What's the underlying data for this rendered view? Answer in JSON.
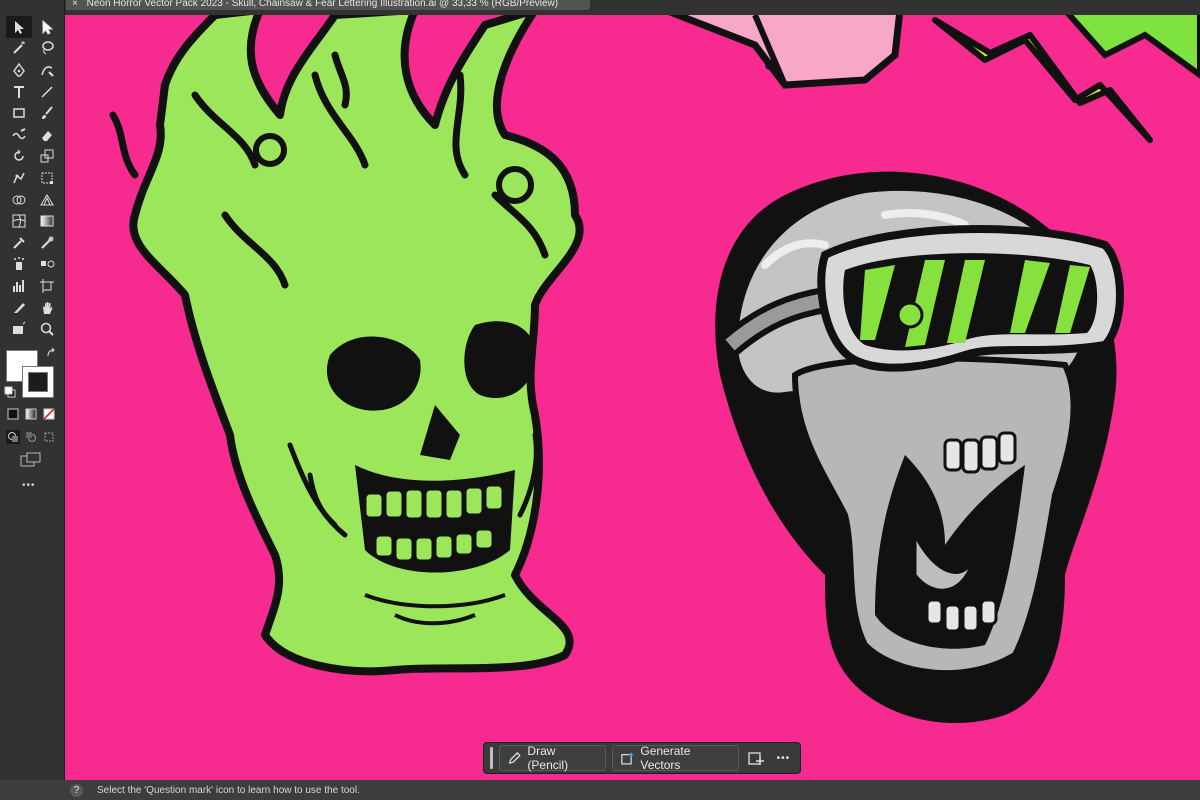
{
  "document_tab": {
    "close_glyph": "×",
    "title": "Neon Horror Vector Pack 2023 - Skull, Chainsaw & Fear Lettering Illustration.ai @ 33,33 % (RGB/Preview)"
  },
  "toolbar": {
    "tools": [
      {
        "name": "selection-tool-icon",
        "selected": true
      },
      {
        "name": "direct-selection-tool-icon"
      },
      {
        "name": "magic-wand-tool-icon"
      },
      {
        "name": "lasso-tool-icon"
      },
      {
        "name": "pen-tool-icon"
      },
      {
        "name": "curvature-tool-icon"
      },
      {
        "name": "type-tool-icon"
      },
      {
        "name": "line-segment-tool-icon"
      },
      {
        "name": "rectangle-tool-icon"
      },
      {
        "name": "paintbrush-tool-icon"
      },
      {
        "name": "shaper-tool-icon"
      },
      {
        "name": "eraser-tool-icon"
      },
      {
        "name": "rotate-tool-icon"
      },
      {
        "name": "scale-tool-icon"
      },
      {
        "name": "puppet-warp-tool-icon"
      },
      {
        "name": "free-transform-tool-icon"
      },
      {
        "name": "shape-builder-tool-icon"
      },
      {
        "name": "perspective-grid-tool-icon"
      },
      {
        "name": "mesh-tool-icon"
      },
      {
        "name": "gradient-tool-icon"
      },
      {
        "name": "eyedropper-tool-icon"
      },
      {
        "name": "measure-tool-icon"
      },
      {
        "name": "symbol-sprayer-tool-icon"
      },
      {
        "name": "blend-tool-icon"
      },
      {
        "name": "column-graph-tool-icon"
      },
      {
        "name": "artboard-tool-icon"
      },
      {
        "name": "slice-tool-icon"
      },
      {
        "name": "hand-tool-icon"
      },
      {
        "name": "toggle-screen-mode-icon"
      },
      {
        "name": "zoom-tool-icon"
      }
    ],
    "fill_color": "#ffffff",
    "stroke_color": "#1c1c1c",
    "more_glyph": "•••"
  },
  "contextual_bar": {
    "draw_label": "Draw (Pencil)",
    "generate_label": "Generate Vectors",
    "more_glyph": "•••"
  },
  "status_bar": {
    "help_glyph": "?",
    "message": "Select the 'Question mark' icon to learn how to use the tool."
  },
  "colors": {
    "canvas_bg": "#f72a90",
    "neon_green": "#9be65a",
    "outline": "#111111",
    "ui_dark": "#323232"
  }
}
